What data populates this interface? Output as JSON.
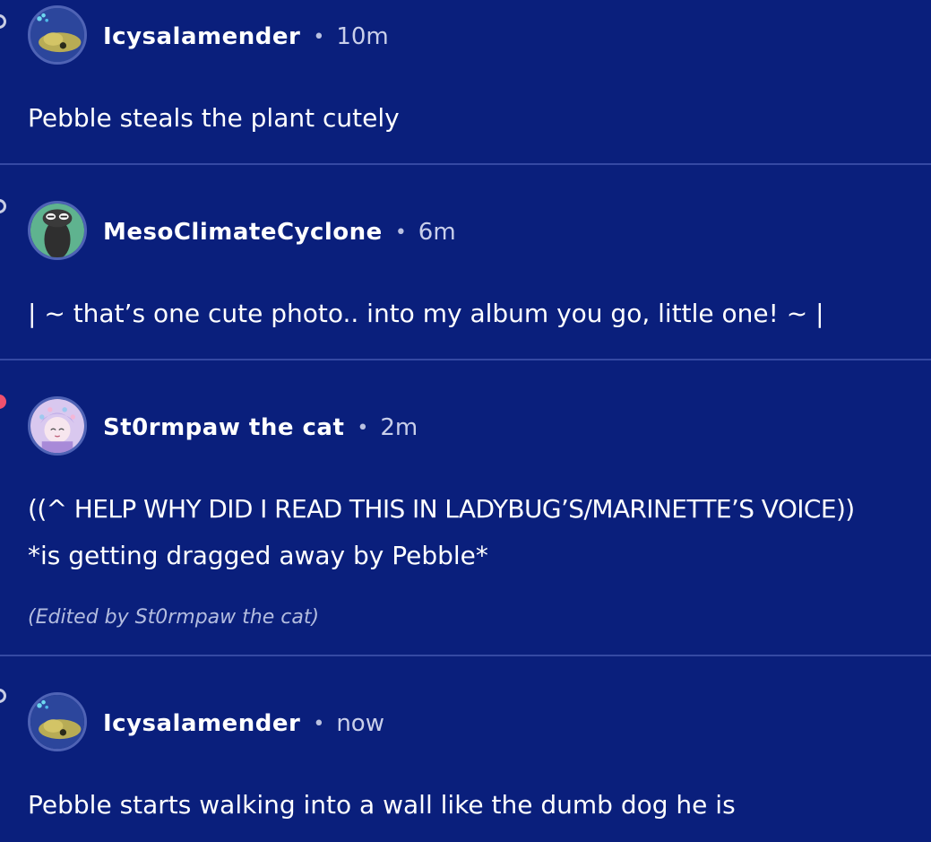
{
  "comments": [
    {
      "username": "Icysalamender",
      "separator": "•",
      "time": "10m",
      "body": [
        "Pebble steals the plant cutely"
      ],
      "avatar": "axolotl-plush-avatar"
    },
    {
      "username": "MesoClimateCyclone",
      "separator": "•",
      "time": "6m",
      "body": [
        "| ~ that’s one cute photo.. into my album you go, little one! ~ |"
      ],
      "avatar": "dark-creature-avatar"
    },
    {
      "username": "St0rmpaw the cat",
      "separator": "•",
      "time": "2m",
      "body": [
        "((^ HELP WHY DID I READ THIS IN LADYBUG’S/MARINETTE’S VOICE))",
        "*is getting dragged away by Pebble*"
      ],
      "edited": "(Edited by St0rmpaw the cat)",
      "avatar": "anime-character-avatar"
    },
    {
      "username": "Icysalamender",
      "separator": "•",
      "time": "now",
      "body": [
        "Pebble starts walking into a wall like the dumb dog he is"
      ],
      "avatar": "axolotl-plush-avatar"
    }
  ],
  "colors": {
    "background": "#0a1f7c",
    "divider": "#3549a3",
    "text": "#ffffff",
    "meta_text": "#c9cfea",
    "unread_dot": "#f0506e"
  }
}
